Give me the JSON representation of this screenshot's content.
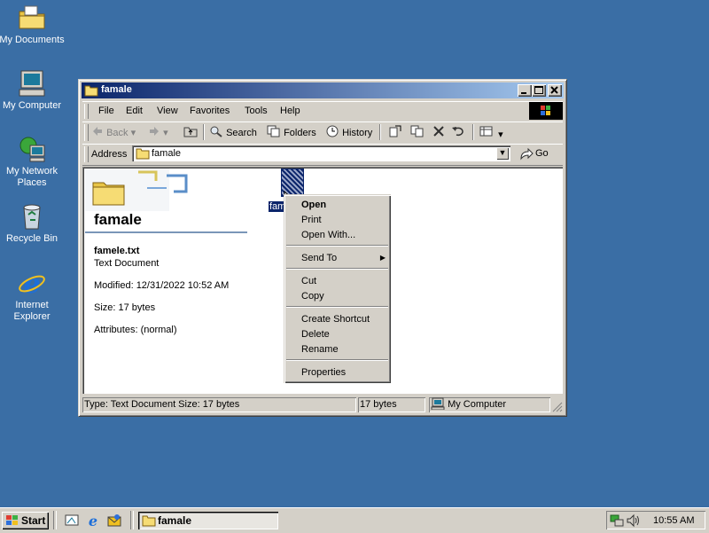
{
  "desktop": {
    "icons": [
      {
        "label": "My Documents",
        "icon": "my-documents-icon"
      },
      {
        "label": "My Computer",
        "icon": "my-computer-icon"
      },
      {
        "label": "My Network",
        "label2": "Places",
        "icon": "network-places-icon"
      },
      {
        "label": "Recycle Bin",
        "icon": "recycle-bin-icon"
      },
      {
        "label": "Internet",
        "label2": "Explorer",
        "icon": "internet-explorer-icon"
      }
    ]
  },
  "window": {
    "title": "famale",
    "menu": [
      "File",
      "Edit",
      "View",
      "Favorites",
      "Tools",
      "Help"
    ],
    "toolbar": {
      "back": "Back",
      "search": "Search",
      "folders": "Folders",
      "history": "History"
    },
    "address": {
      "label": "Address",
      "value": "famale",
      "go": "Go"
    },
    "webview": {
      "folder_title": "famale",
      "file_name": "famele.txt",
      "file_type": "Text Document",
      "modified": "Modified: 12/31/2022 10:52 AM",
      "size": "Size: 17 bytes",
      "attributes": "Attributes: (normal)"
    },
    "selected_file_label": "fam",
    "status": {
      "info": "Type: Text Document Size: 17 bytes",
      "size": "17 bytes",
      "zone": "My Computer"
    }
  },
  "context_menu": {
    "items": [
      "Open",
      "Print",
      "Open With...",
      "Send To",
      "Cut",
      "Copy",
      "Create Shortcut",
      "Delete",
      "Rename",
      "Properties"
    ]
  },
  "taskbar": {
    "start": "Start",
    "task": "famale",
    "clock": "10:55 AM"
  },
  "colors": {
    "desktop": "#3a6ea5",
    "titlebar": "#0a246a",
    "face": "#d4d0c8",
    "selection": "#0a246a"
  }
}
